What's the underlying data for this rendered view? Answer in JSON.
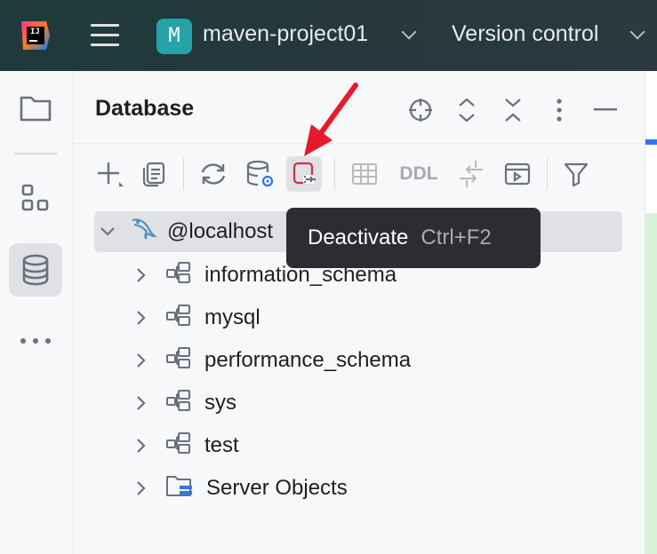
{
  "titlebar": {
    "logo_text": "IJ",
    "project_badge": "M",
    "project_name": "maven-project01",
    "vcs_label": "Version control"
  },
  "left_strip": {
    "icons": [
      "folder-icon",
      "structure-icon",
      "database-icon",
      "more-icon"
    ]
  },
  "panel": {
    "title": "Database",
    "header_icons": [
      "locate-icon",
      "expand-all-icon",
      "collapse-all-icon",
      "options-icon",
      "minimize-icon"
    ],
    "toolbar": {
      "ddl_label": "DDL",
      "icons": [
        "add-icon",
        "duplicate-icon",
        "refresh-icon",
        "data-source-properties-icon",
        "deactivate-icon",
        "table-editor-icon",
        "jump-to-console-icon",
        "compare-icon",
        "console-icon",
        "filter-icon"
      ]
    },
    "tree": {
      "root": "@localhost",
      "children": [
        {
          "label": "information_schema",
          "icon": "schema-icon"
        },
        {
          "label": "mysql",
          "icon": "schema-icon"
        },
        {
          "label": "performance_schema",
          "icon": "schema-icon"
        },
        {
          "label": "sys",
          "icon": "schema-icon"
        },
        {
          "label": "test",
          "icon": "schema-icon"
        },
        {
          "label": "Server Objects",
          "icon": "server-folder-icon"
        }
      ]
    }
  },
  "tooltip": {
    "label": "Deactivate",
    "shortcut": "Ctrl+F2"
  },
  "colors": {
    "titlebar_bg": "#1f3a3b",
    "project_badge": "#26a3a8",
    "deactivate_red": "#d1313d",
    "arrow_red": "#e8192c",
    "selection": "#dfe1e5",
    "tooltip_bg": "#2b2d30"
  }
}
